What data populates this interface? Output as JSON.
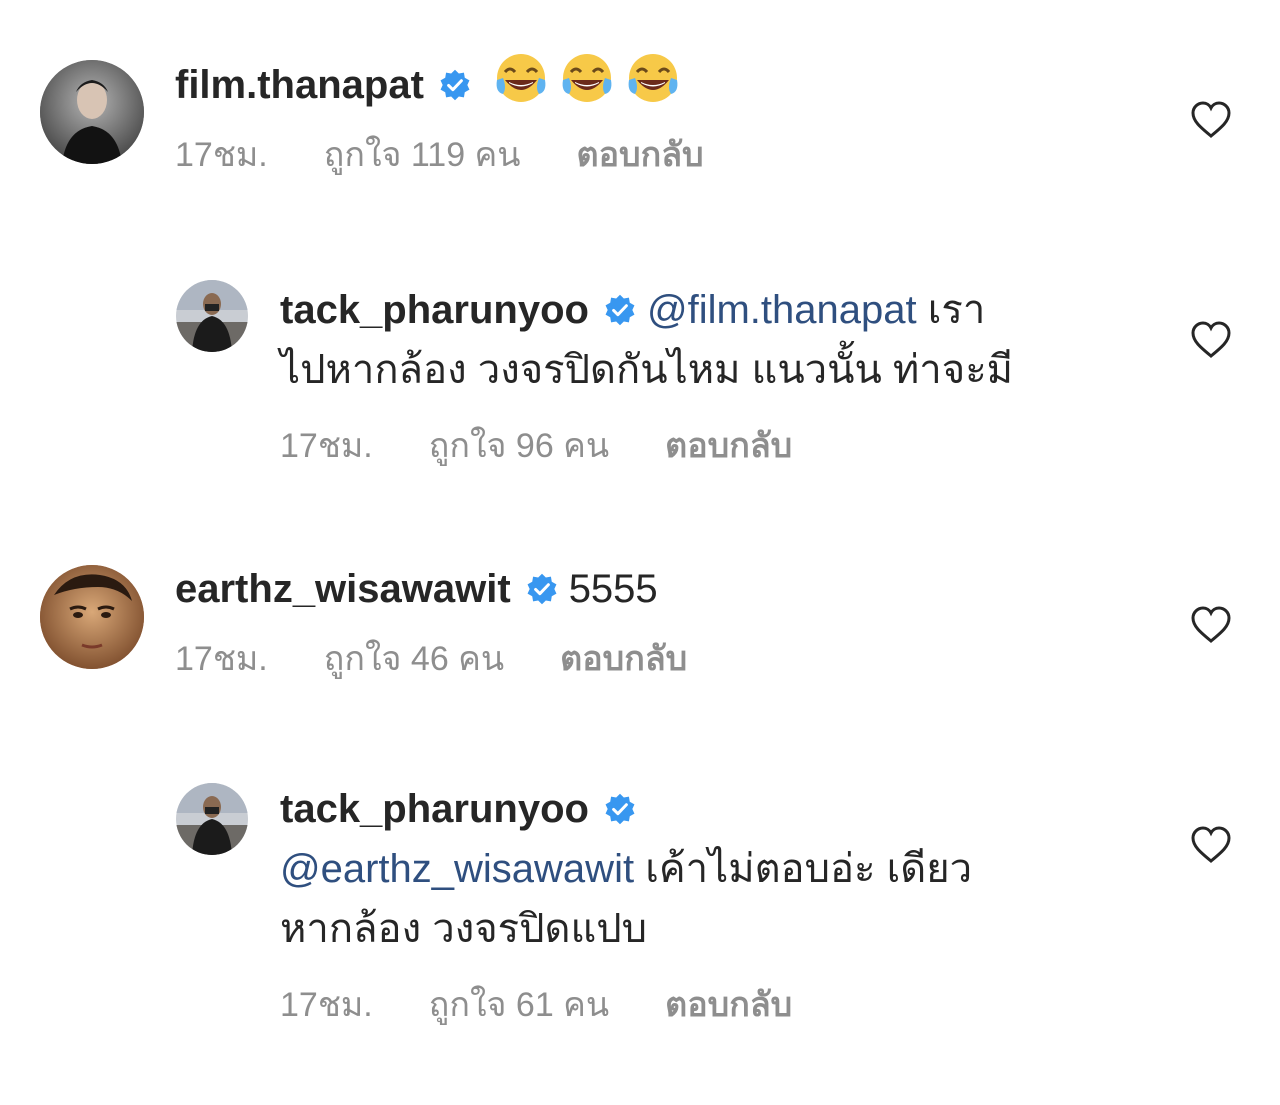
{
  "comments": [
    {
      "username": "film.thanapat",
      "text": "",
      "emoji_count": 3,
      "emoji_icon": "face-with-tears-of-joy-icon",
      "time": "17ชม.",
      "likes": "ถูกใจ 119 คน",
      "reply": "ตอบกลับ"
    },
    {
      "username": "tack_pharunyoo",
      "mention": "@film.thanapat",
      "text_line1": "เรา",
      "text_line2": "ไปหากล้อง วงจรปิดกันไหม แนวนั้น ท่าจะมี",
      "time": "17ชม.",
      "likes": "ถูกใจ 96 คน",
      "reply": "ตอบกลับ"
    },
    {
      "username": "earthz_wisawawit",
      "text": "5555",
      "time": "17ชม.",
      "likes": "ถูกใจ 46 คน",
      "reply": "ตอบกลับ"
    },
    {
      "username": "tack_pharunyoo",
      "mention": "@earthz_wisawawit",
      "text_line2": "เค้าไม่ตอบอ่ะ เดียว",
      "text_line3": "หากล้อง วงจรปิดแปบ",
      "time": "17ชม.",
      "likes": "ถูกใจ 61 คน",
      "reply": "ตอบกลับ"
    }
  ],
  "colors": {
    "verified": "#3897f0",
    "mention": "#2f4f7f",
    "meta": "#8e8e8e",
    "text": "#262626"
  }
}
